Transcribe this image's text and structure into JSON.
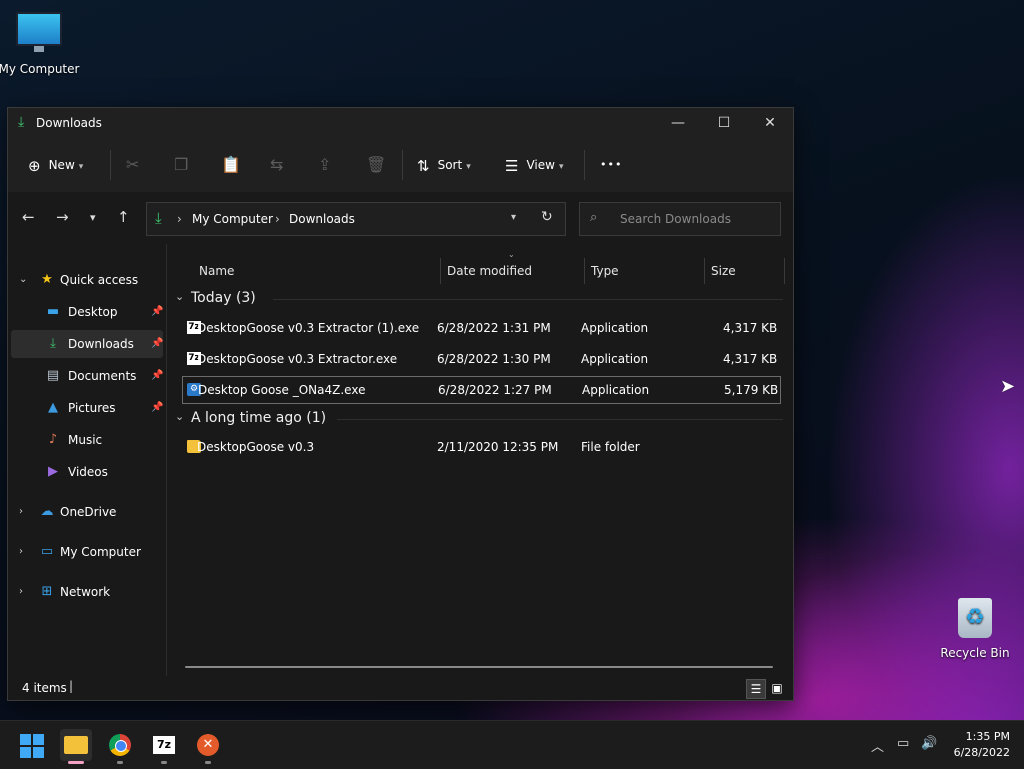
{
  "desktop": {
    "my_computer_label": "My Computer",
    "recycle_bin_label": "Recycle Bin"
  },
  "window": {
    "title": "Downloads",
    "controls": {
      "minimize": "—",
      "maximize": "☐",
      "close": "✕"
    }
  },
  "commandbar": {
    "new_label": "New",
    "sort_label": "Sort",
    "view_label": "View",
    "more_label": "•••"
  },
  "address": {
    "crumbs": [
      "My Computer",
      "Downloads"
    ],
    "search_placeholder": "Search Downloads"
  },
  "sidebar": {
    "quick_access": "Quick access",
    "items": [
      {
        "label": "Desktop",
        "icon": "desktop-icon"
      },
      {
        "label": "Downloads",
        "icon": "download-icon"
      },
      {
        "label": "Documents",
        "icon": "document-icon"
      },
      {
        "label": "Pictures",
        "icon": "pictures-icon"
      },
      {
        "label": "Music",
        "icon": "music-icon"
      },
      {
        "label": "Videos",
        "icon": "videos-icon"
      }
    ],
    "onedrive": "OneDrive",
    "my_computer": "My Computer",
    "network": "Network"
  },
  "columns": {
    "name": "Name",
    "date": "Date modified",
    "type": "Type",
    "size": "Size"
  },
  "groups": [
    {
      "title": "Today (3)",
      "rows": [
        {
          "name": "DesktopGoose v0.3 Extractor (1).exe",
          "date": "6/28/2022 1:31 PM",
          "type": "Application",
          "size": "4,317 KB"
        },
        {
          "name": "DesktopGoose v0.3 Extractor.exe",
          "date": "6/28/2022 1:30 PM",
          "type": "Application",
          "size": "4,317 KB"
        },
        {
          "name": "Desktop Goose _ONa4Z.exe",
          "date": "6/28/2022 1:27 PM",
          "type": "Application",
          "size": "5,179 KB"
        }
      ]
    },
    {
      "title": "A long time ago (1)",
      "rows": [
        {
          "name": "DesktopGoose v0.3",
          "date": "2/11/2020 12:35 PM",
          "type": "File folder",
          "size": ""
        }
      ]
    }
  ],
  "status": {
    "items": "4 items"
  },
  "taskbar": {
    "time": "1:35 PM",
    "date": "6/28/2022",
    "sevenzip_label": "7z"
  },
  "colors": {
    "accent": "#3fa9f5",
    "download_green": "#3ec46d",
    "star_yellow": "#f5c518"
  }
}
